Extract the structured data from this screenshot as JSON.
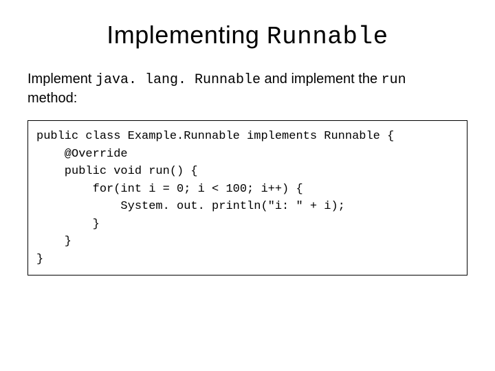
{
  "title": {
    "prefix": "Implementing ",
    "mono": "Runnable"
  },
  "desc": {
    "t1": "Implement ",
    "m1": "java. lang. Runnable",
    "t2": " and implement the ",
    "m2": "run",
    "t3": "method:"
  },
  "code": {
    "l1": "public class Example.Runnable implements Runnable {",
    "l2": "    @Override",
    "l3": "    public void run() {",
    "l4": "        for(int i = 0; i < 100; i++) {",
    "l5": "            System. out. println(\"i: \" + i);",
    "l6": "        }",
    "l7": "    }",
    "l8": "}"
  }
}
